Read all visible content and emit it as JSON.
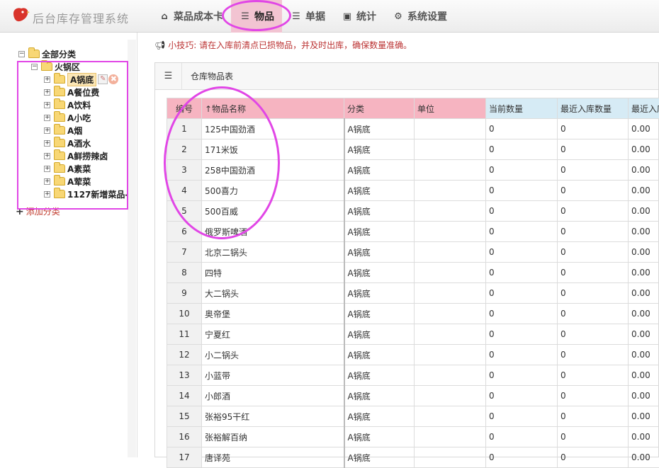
{
  "app": {
    "title": "后台库存管理系统",
    "brand_color": "#d9342b"
  },
  "nav": {
    "items": [
      {
        "label": "菜品成本卡",
        "icon": "home-icon"
      },
      {
        "label": "物品",
        "icon": "list-icon",
        "active": true
      },
      {
        "label": "单据",
        "icon": "list-icon"
      },
      {
        "label": "统计",
        "icon": "image-icon"
      },
      {
        "label": "系统设置",
        "icon": "gear-icon"
      }
    ]
  },
  "tree": {
    "root": "全部分类",
    "group": "火锅区",
    "items": [
      "A锅底",
      "A餐位费",
      "A饮料",
      "A小吃",
      "A烟",
      "A酒水",
      "A鲜捞辣卤",
      "A素菜",
      "A荤菜",
      "1127新增菜品-"
    ],
    "selected": "A锅底",
    "add_label": "添加分类"
  },
  "tip": {
    "text": "小技巧: 请在入库前清点已损物品，并及时出库，确保数量准确。"
  },
  "panel": {
    "title": "仓库物品表"
  },
  "table": {
    "headers": [
      "编号",
      "↑物品名称",
      "分类",
      "单位",
      "当前数量",
      "最近入库数量",
      "最近入库"
    ],
    "rows": [
      [
        "1",
        "125中国劲酒",
        "A锅底",
        "",
        "0",
        "0",
        "0.00"
      ],
      [
        "2",
        "171米饭",
        "A锅底",
        "",
        "0",
        "0",
        "0.00"
      ],
      [
        "3",
        "258中国劲酒",
        "A锅底",
        "",
        "0",
        "0",
        "0.00"
      ],
      [
        "4",
        "500喜力",
        "A锅底",
        "",
        "0",
        "0",
        "0.00"
      ],
      [
        "5",
        "500百威",
        "A锅底",
        "",
        "0",
        "0",
        "0.00"
      ],
      [
        "6",
        "俄罗斯啤酒",
        "A锅底",
        "",
        "0",
        "0",
        "0.00"
      ],
      [
        "7",
        "北京二锅头",
        "A锅底",
        "",
        "0",
        "0",
        "0.00"
      ],
      [
        "8",
        "四特",
        "A锅底",
        "",
        "0",
        "0",
        "0.00"
      ],
      [
        "9",
        "大二锅头",
        "A锅底",
        "",
        "0",
        "0",
        "0.00"
      ],
      [
        "10",
        "奥帝堡",
        "A锅底",
        "",
        "0",
        "0",
        "0.00"
      ],
      [
        "11",
        "宁夏红",
        "A锅底",
        "",
        "0",
        "0",
        "0.00"
      ],
      [
        "12",
        "小二锅头",
        "A锅底",
        "",
        "0",
        "0",
        "0.00"
      ],
      [
        "13",
        "小蓝带",
        "A锅底",
        "",
        "0",
        "0",
        "0.00"
      ],
      [
        "14",
        "小郎酒",
        "A锅底",
        "",
        "0",
        "0",
        "0.00"
      ],
      [
        "15",
        "张裕95干红",
        "A锅底",
        "",
        "0",
        "0",
        "0.00"
      ],
      [
        "16",
        "张裕解百纳",
        "A锅底",
        "",
        "0",
        "0",
        "0.00"
      ],
      [
        "17",
        "唐译苑",
        "A锅底",
        "",
        "0",
        "0",
        "0.00"
      ]
    ]
  }
}
